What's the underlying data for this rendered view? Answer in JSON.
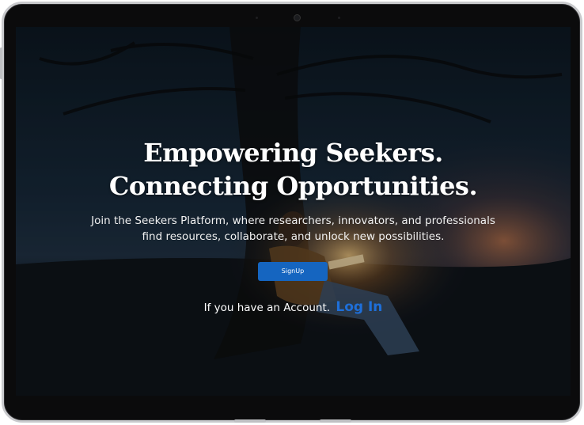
{
  "hero": {
    "headline_line1": "Empowering Seekers.",
    "headline_line2": "Connecting Opportunities.",
    "subtitle_line1": "Join the Seekers Platform, where researchers, innovators, and professionals",
    "subtitle_line2": "find resources, collaborate, and unlock new possibilities."
  },
  "actions": {
    "signup_label": "SignUp",
    "account_prompt": "If you have an Account.",
    "login_label": "Log In"
  },
  "colors": {
    "primary_button": "#1565c0",
    "login_link": "#1e6fd9",
    "text": "#ffffff"
  }
}
